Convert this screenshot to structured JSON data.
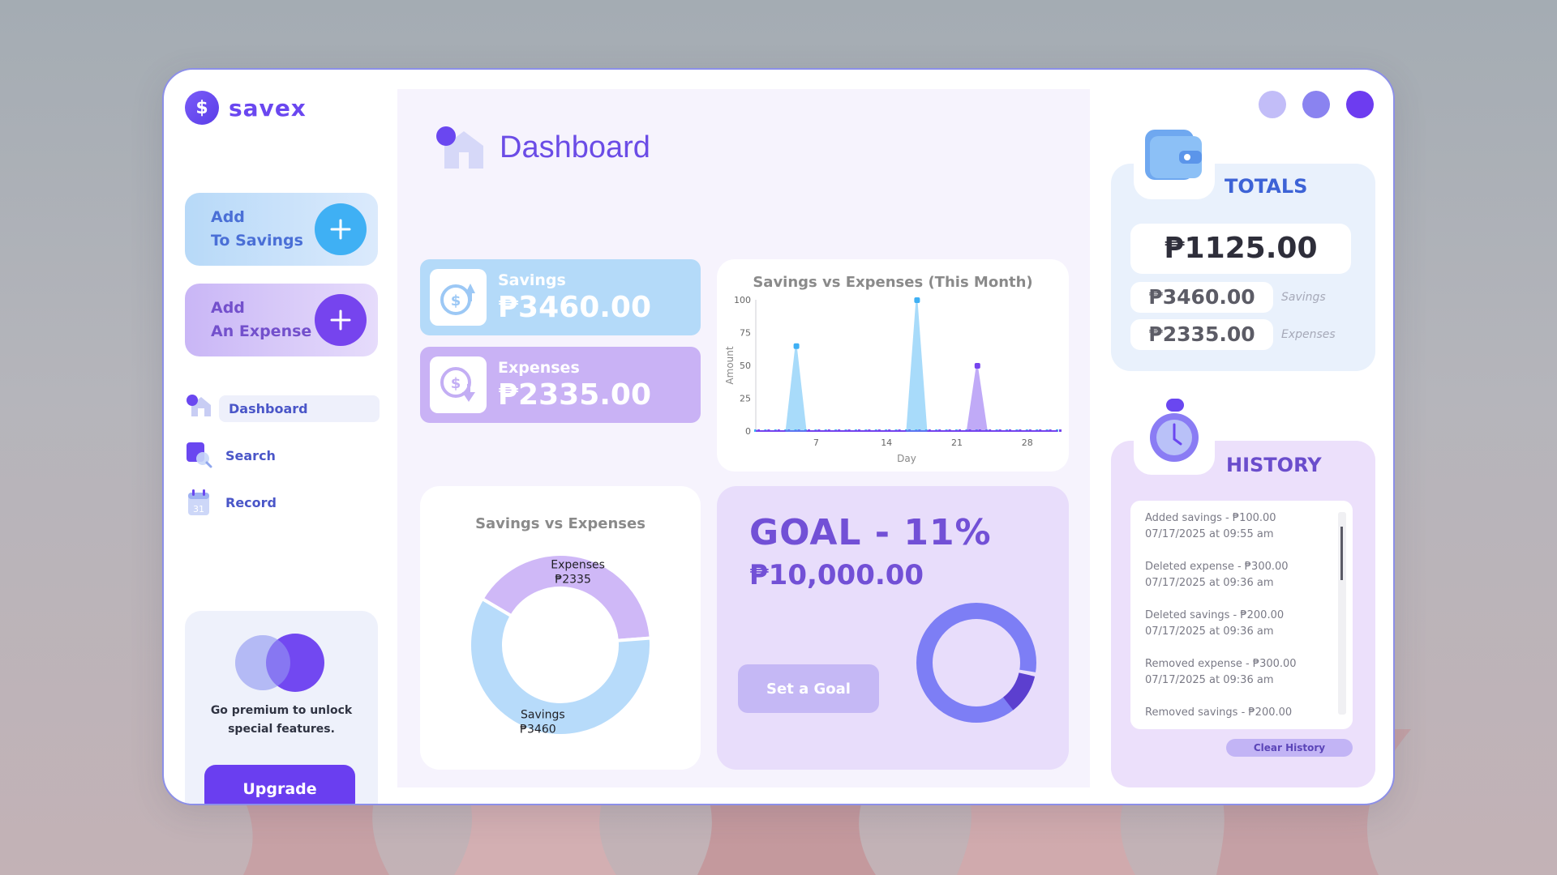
{
  "app": {
    "name": "savex",
    "logo_symbol": "$"
  },
  "colors": {
    "accent": "#6a3ef0",
    "savings": "#b4daf9",
    "expenses": "#c9b2f5",
    "line_savings": "#3fb0f4",
    "line_expenses": "#7644ee"
  },
  "sidebar": {
    "add_savings": {
      "line1": "Add",
      "line2": "To Savings"
    },
    "add_expense": {
      "line1": "Add",
      "line2": "An Expense"
    },
    "nav": [
      {
        "label": "Dashboard",
        "icon": "home-icon"
      },
      {
        "label": "Search",
        "icon": "search-icon"
      },
      {
        "label": "Record",
        "icon": "calendar-icon",
        "icon_text": "31"
      }
    ],
    "premium": {
      "text": "Go premium to unlock special features.",
      "button": "Upgrade"
    }
  },
  "main": {
    "title": "Dashboard",
    "savings_card": {
      "label": "Savings",
      "value": "₱3460.00"
    },
    "expenses_card": {
      "label": "Expenses",
      "value": "₱2335.00"
    },
    "goal": {
      "title": "GOAL - 11%",
      "amount": "₱10,000.00",
      "button": "Set a Goal",
      "progress": 0.11
    }
  },
  "chart_data": [
    {
      "type": "line",
      "title": "Savings vs Expenses (This Month)",
      "xlabel": "Day",
      "ylabel": "Amount",
      "xlim": [
        1,
        31
      ],
      "ylim": [
        0,
        100
      ],
      "xticks": [
        7,
        14,
        21,
        28
      ],
      "yticks": [
        0,
        25,
        50,
        75,
        100
      ],
      "series": [
        {
          "name": "Savings",
          "color": "#3fb0f4",
          "spikes": [
            {
              "x": 5,
              "y": 65
            },
            {
              "x": 17,
              "y": 100
            }
          ]
        },
        {
          "name": "Expenses",
          "color": "#7644ee",
          "spikes": [
            {
              "x": 23,
              "y": 50
            }
          ]
        }
      ]
    },
    {
      "type": "pie",
      "title": "Savings vs Expenses",
      "slices": [
        {
          "label": "Expenses",
          "value": 2335,
          "value_label": "₱2335",
          "color": "#cfb8f7"
        },
        {
          "label": "Savings",
          "value": 3460,
          "value_label": "₱3460",
          "color": "#b7dbfa"
        }
      ]
    }
  ],
  "totals": {
    "title": "TOTALS",
    "total": "₱1125.00",
    "savings": "₱3460.00",
    "savings_caption": "Savings",
    "expenses": "₱2335.00",
    "expenses_caption": "Expenses"
  },
  "history": {
    "title": "HISTORY",
    "items": [
      {
        "line1": "Added savings - ₱100.00",
        "line2": "07/17/2025 at 09:55 am"
      },
      {
        "line1": "Deleted expense - ₱300.00",
        "line2": "07/17/2025 at 09:36 am"
      },
      {
        "line1": "Deleted savings - ₱200.00",
        "line2": "07/17/2025 at 09:36 am"
      },
      {
        "line1": "Removed expense - ₱300.00",
        "line2": "07/17/2025 at 09:36 am"
      },
      {
        "line1": "Removed savings - ₱200.00",
        "line2": ""
      }
    ],
    "clear_button": "Clear History"
  }
}
